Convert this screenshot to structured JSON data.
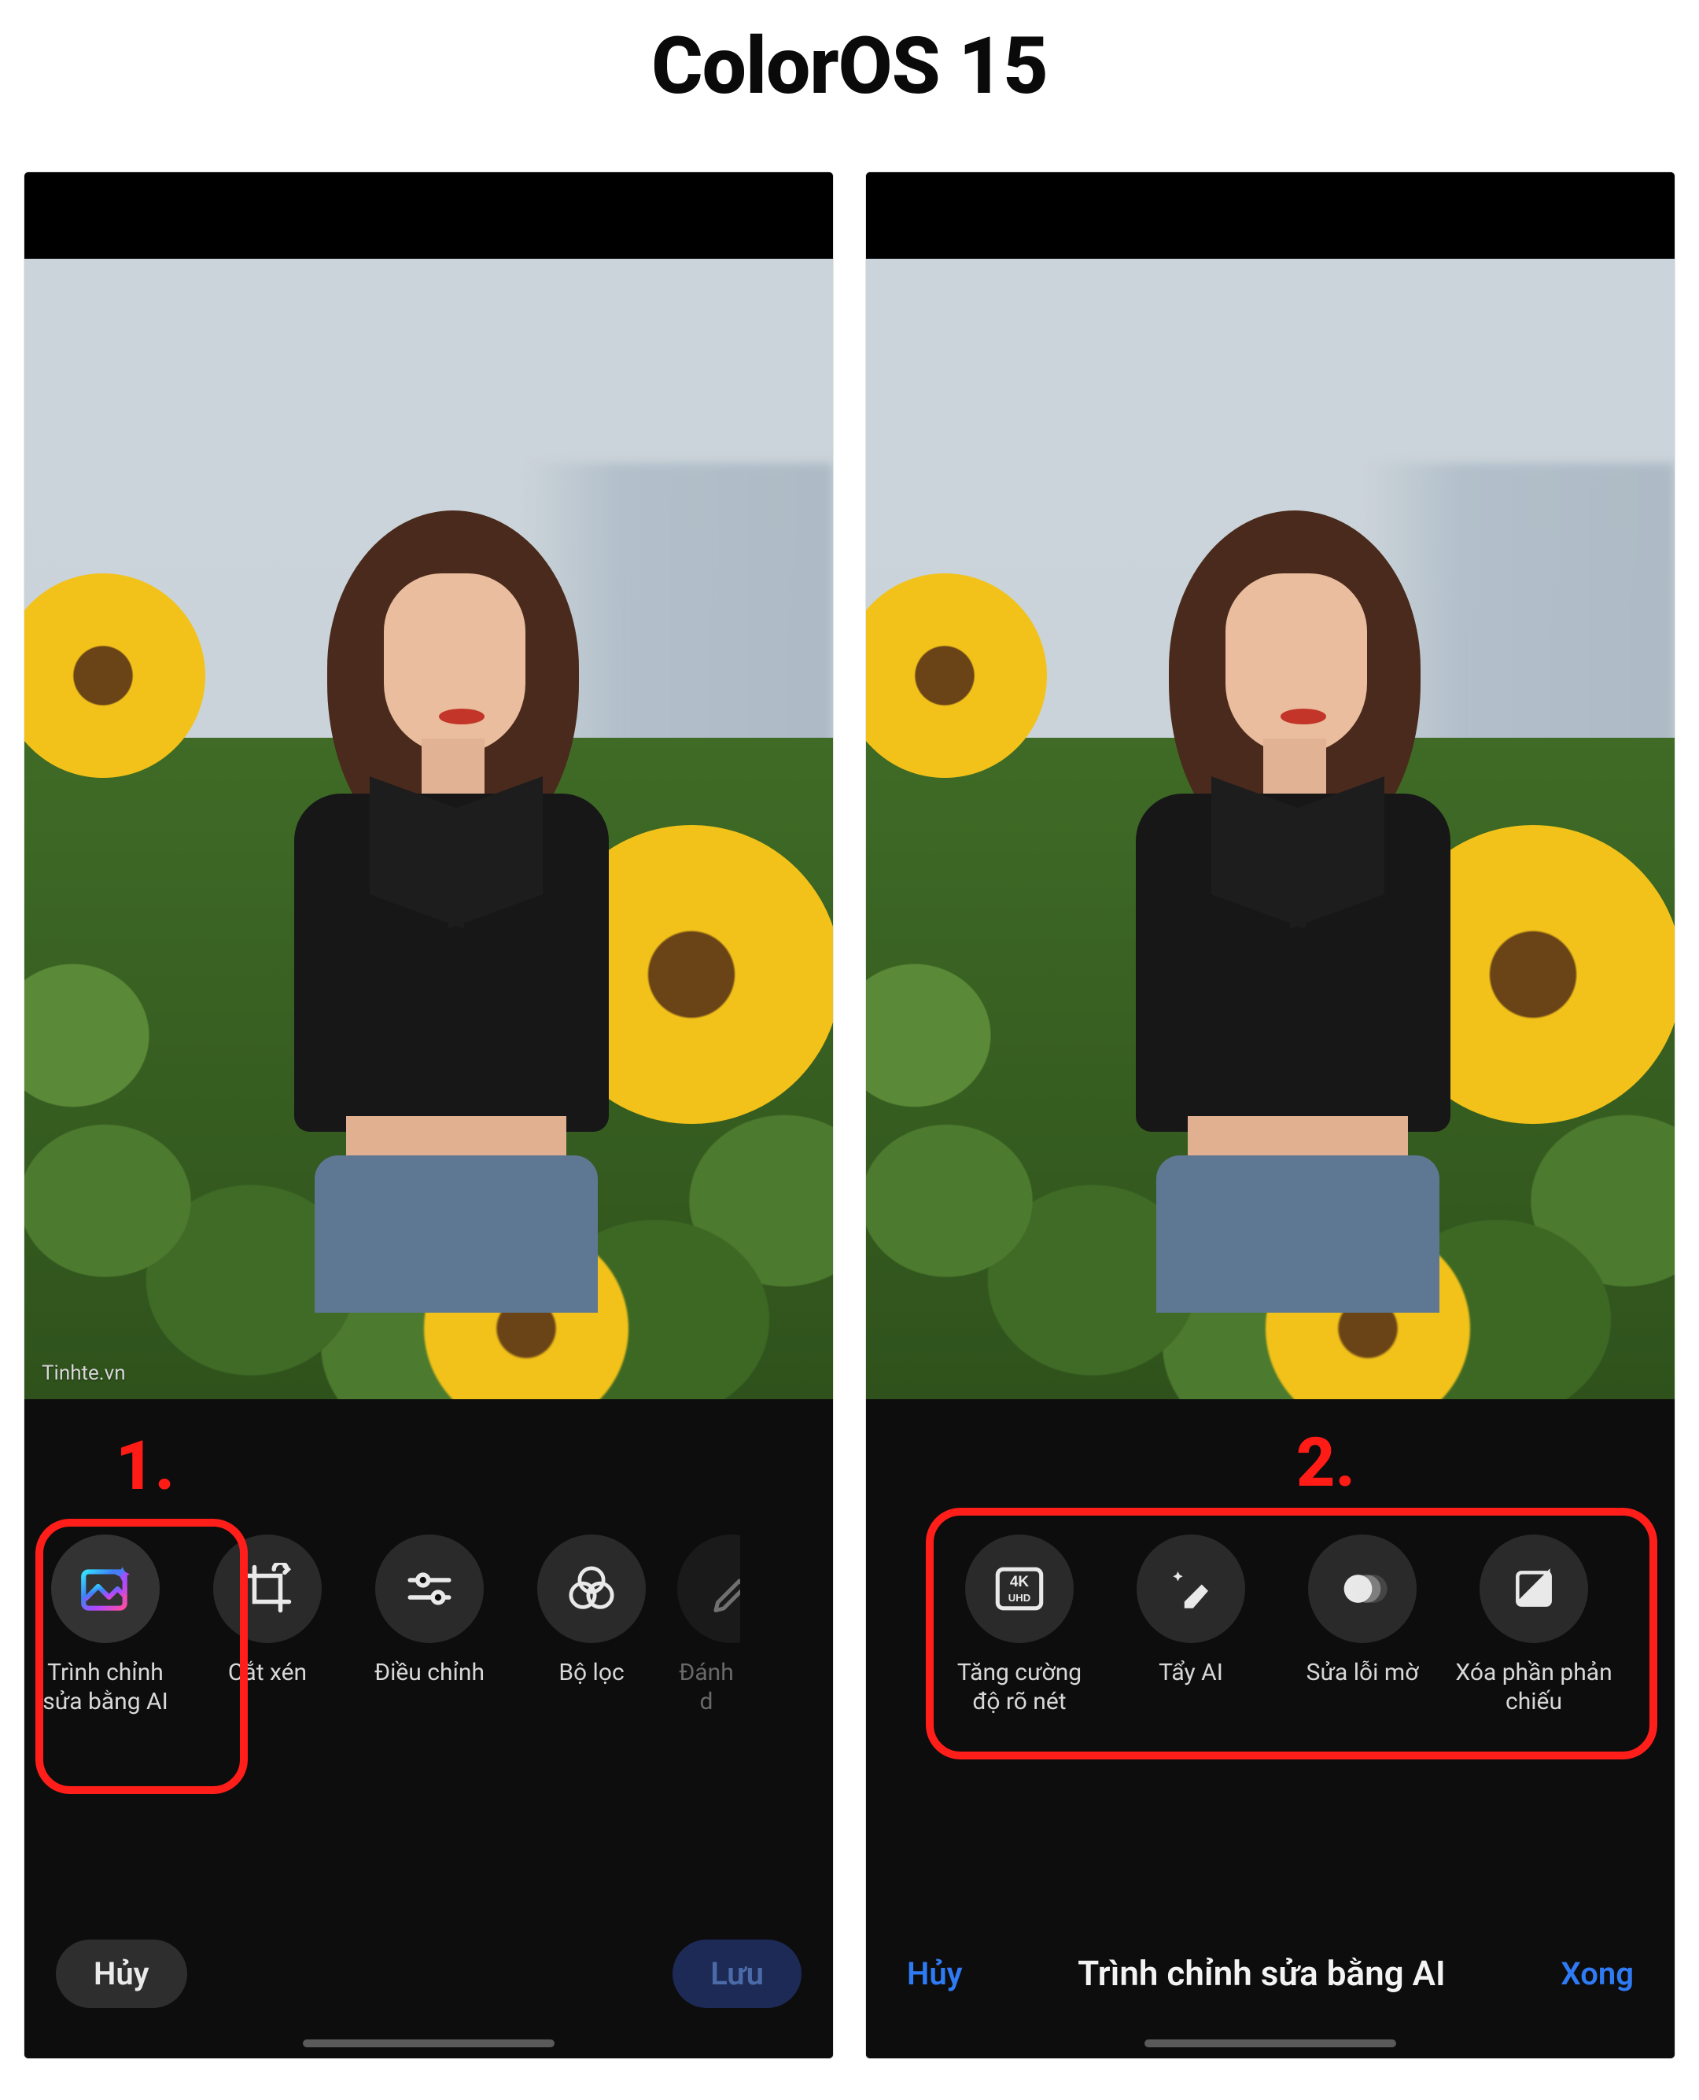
{
  "page_title": "ColorOS 15",
  "steps": {
    "s1": "1.",
    "s2": "2."
  },
  "watermark": "Tinhte.vn",
  "left": {
    "tools": [
      {
        "id": "ai-editor",
        "label": "Trình chỉnh sửa bằng AI",
        "icon": "ai-sparkle-frame-icon",
        "selected": true
      },
      {
        "id": "crop",
        "label": "Cắt xén",
        "icon": "crop-icon"
      },
      {
        "id": "adjust",
        "label": "Điều chỉnh",
        "icon": "sliders-icon"
      },
      {
        "id": "filter",
        "label": "Bộ lọc",
        "icon": "filter-circles-icon"
      },
      {
        "id": "markup",
        "label": "Đánh d",
        "icon": "pencil-icon",
        "cut": true
      }
    ],
    "footer": {
      "cancel": "Hủy",
      "save": "Lưu"
    }
  },
  "right": {
    "tools": [
      {
        "id": "sharpen",
        "label": "Tăng cường độ rõ nét",
        "icon": "fourk-uhd-icon"
      },
      {
        "id": "eraser",
        "label": "Tẩy AI",
        "icon": "eraser-sparkle-icon"
      },
      {
        "id": "deblur",
        "label": "Sửa lỗi mờ",
        "icon": "blur-circle-icon"
      },
      {
        "id": "reflect",
        "label": "Xóa phần phản chiếu",
        "icon": "split-square-icon"
      }
    ],
    "footer": {
      "cancel": "Hủy",
      "title": "Trình chỉnh sửa bằng AI",
      "done": "Xong"
    }
  },
  "colors": {
    "highlight": "#ff1e19",
    "accent": "#2f7bf5"
  }
}
